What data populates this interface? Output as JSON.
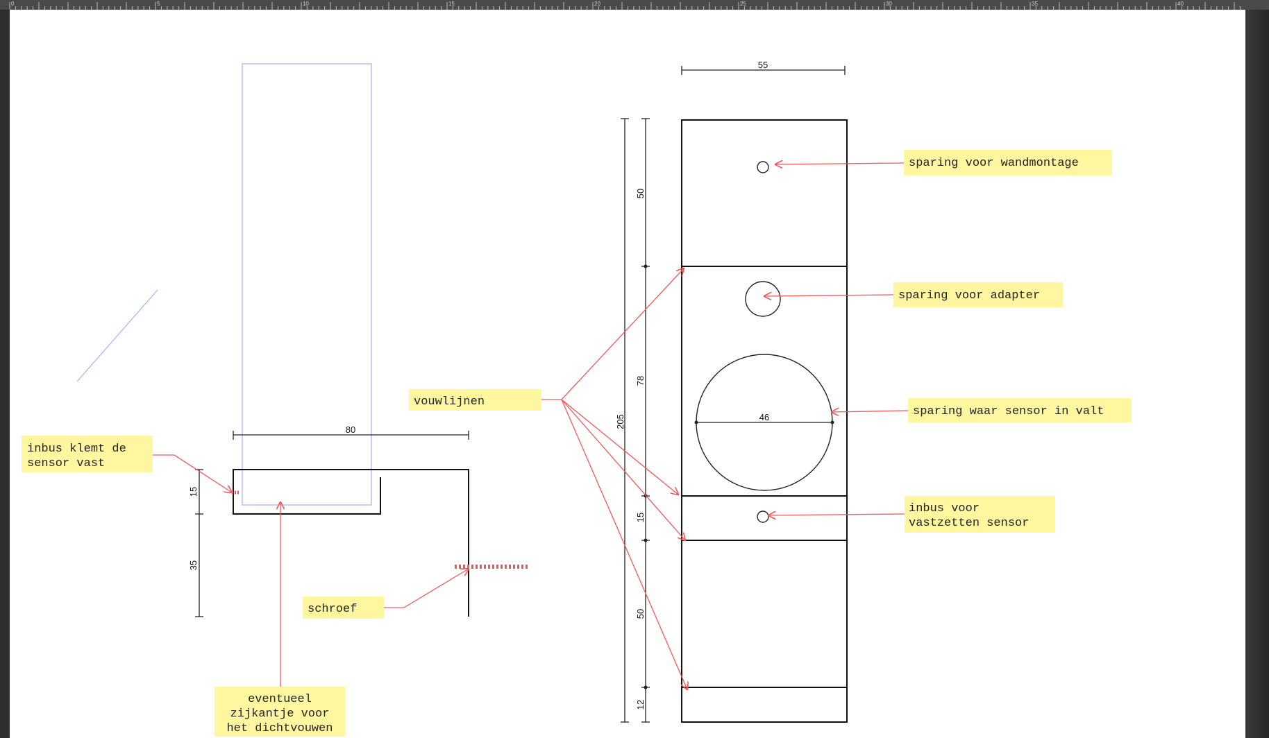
{
  "ruler": {
    "labels": [
      "0",
      "5",
      "10",
      "15",
      "20",
      "25",
      "30",
      "35",
      "40"
    ]
  },
  "notes": {
    "inbus_klemt": [
      "inbus klemt de",
      "sensor vast"
    ],
    "eventueel": [
      "eventueel",
      "zijkantje voor",
      "het dichtvouwen"
    ],
    "schroef": [
      "schroef"
    ],
    "vouwlijnen": [
      "vouwlijnen"
    ],
    "wandmontage": [
      "sparing voor wandmontage"
    ],
    "adapter": [
      "sparing voor adapter"
    ],
    "sensor_valt": [
      "sparing waar sensor in valt"
    ],
    "inbus_vastzetten": [
      "inbus voor",
      "vastzetten sensor"
    ]
  },
  "dimensions": {
    "width_80": "80",
    "h_15": "15",
    "h_35": "35",
    "width_55": "55",
    "total_205": "205",
    "seg_50_top": "50",
    "seg_78": "78",
    "seg_15": "15",
    "seg_50_bottom": "50",
    "seg_12": "12",
    "circle_46": "46"
  },
  "colors": {
    "sticky": "#fff7a0",
    "arrow": "#ee5a5a",
    "selection": "#a9b7f2",
    "line": "#111111"
  }
}
